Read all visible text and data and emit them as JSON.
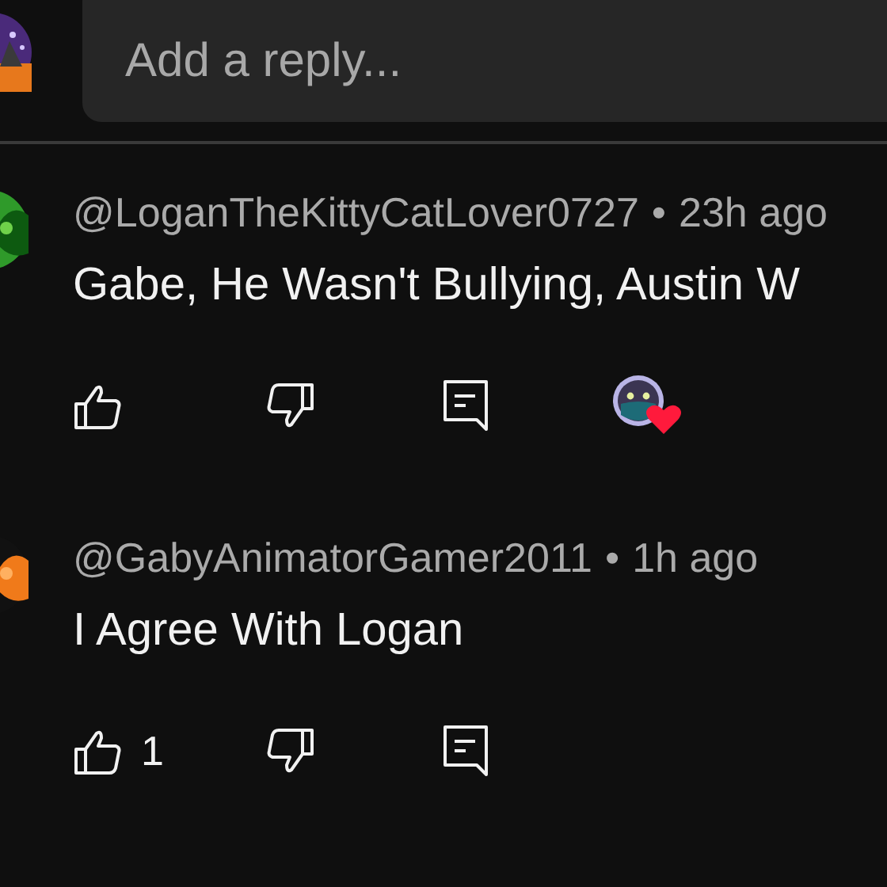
{
  "reply_field": {
    "placeholder": "Add a reply..."
  },
  "comments": [
    {
      "author": "@LoganTheKittyCatLover0727",
      "separator": "•",
      "time": "23h ago",
      "text": "Gabe, He Wasn't Bullying, Austin W",
      "hearted": true
    },
    {
      "author": "@GabyAnimatorGamer2011",
      "separator": "•",
      "time": "1h ago",
      "text": "I Agree With Logan",
      "likes": "1",
      "hearted": false
    }
  ]
}
